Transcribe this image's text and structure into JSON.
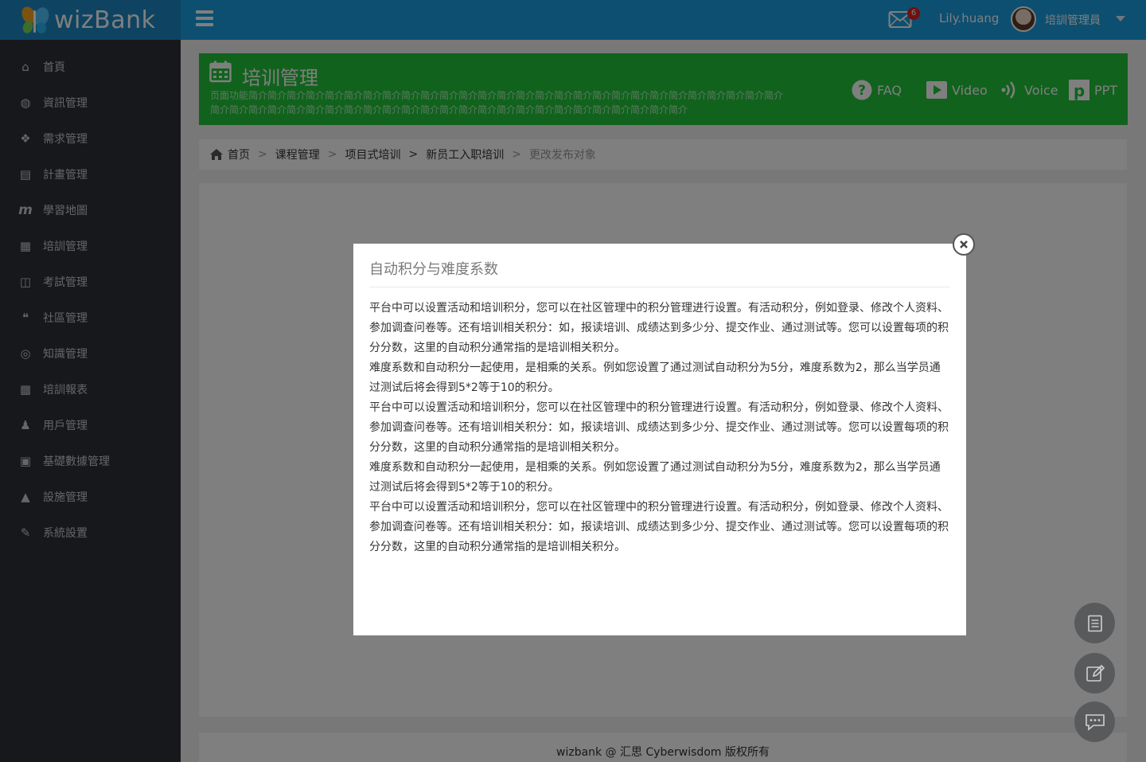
{
  "brand": {
    "name": "wizBank"
  },
  "header": {
    "mail_badge": "6",
    "username": "Lily.huang",
    "role": "培訓管理員"
  },
  "sidebar": {
    "items": [
      {
        "label": "首頁",
        "icon": "home-icon"
      },
      {
        "label": "資訊管理",
        "icon": "globe-icon"
      },
      {
        "label": "需求管理",
        "icon": "cubes-icon"
      },
      {
        "label": "計畫管理",
        "icon": "list-card-icon"
      },
      {
        "label": "學習地圖",
        "icon": "m-icon"
      },
      {
        "label": "培訓管理",
        "icon": "calendar-icon"
      },
      {
        "label": "考試管理",
        "icon": "columns-icon"
      },
      {
        "label": "社區管理",
        "icon": "comments-icon"
      },
      {
        "label": "知識管理",
        "icon": "lifebuoy-icon"
      },
      {
        "label": "培訓報表",
        "icon": "table-icon"
      },
      {
        "label": "用戶管理",
        "icon": "person-icon"
      },
      {
        "label": "基礎數據管理",
        "icon": "briefcase-icon"
      },
      {
        "label": "設施管理",
        "icon": "road-icon"
      },
      {
        "label": "系統設置",
        "icon": "wrench-icon"
      }
    ]
  },
  "banner": {
    "title": "培训管理",
    "intro": "页面功能简介简介简介简介简介简介简介简介简介简介简介简介简介简介简介简介简介简介简介简介简介简介简介简介简介简介简介简介简介简介简介简介简介简介简介简介简介简介简介简介简介简介简介简介简介简介简介简介简介简介简介简介简介",
    "links": {
      "faq": "FAQ",
      "video": "Video",
      "voice": "Voice",
      "ppt": "PPT"
    }
  },
  "breadcrumb": {
    "items": [
      "首页",
      "课程管理",
      "项目式培训",
      "新员工入职培训"
    ],
    "seps": [
      ">",
      ">",
      ">",
      ">"
    ],
    "current": "更改发布对象"
  },
  "footer": {
    "text": "wizbank @ 汇思 Cyberwisdom 版权所有"
  },
  "modal": {
    "title": "自动积分与难度系数",
    "paragraphs": [
      "平台中可以设置活动和培训积分，您可以在社区管理中的积分管理进行设置。有活动积分，例如登录、修改个人资料、参加调查问卷等。还有培训相关积分：如，报读培训、成绩达到多少分、提交作业、通过测试等。您可以设置每项的积分分数，这里的自动积分通常指的是培训相关积分。",
      "难度系数和自动积分一起使用，是相乘的关系。例如您设置了通过测试自动积分为5分，难度系数为2，那么当学员通过测试后将会得到5*2等于10的积分。",
      "平台中可以设置活动和培训积分，您可以在社区管理中的积分管理进行设置。有活动积分，例如登录、修改个人资料、参加调查问卷等。还有培训相关积分：如，报读培训、成绩达到多少分、提交作业、通过测试等。您可以设置每项的积分分数，这里的自动积分通常指的是培训相关积分。",
      "难度系数和自动积分一起使用，是相乘的关系。例如您设置了通过测试自动积分为5分，难度系数为2，那么当学员通过测试后将会得到5*2等于10的积分。",
      "平台中可以设置活动和培训积分，您可以在社区管理中的积分管理进行设置。有活动积分，例如登录、修改个人资料、参加调查问卷等。还有培训相关积分：如，报读培训、成绩达到多少分、提交作业、通过测试等。您可以设置每项的积分分数，这里的自动积分通常指的是培训相关积分。"
    ]
  }
}
